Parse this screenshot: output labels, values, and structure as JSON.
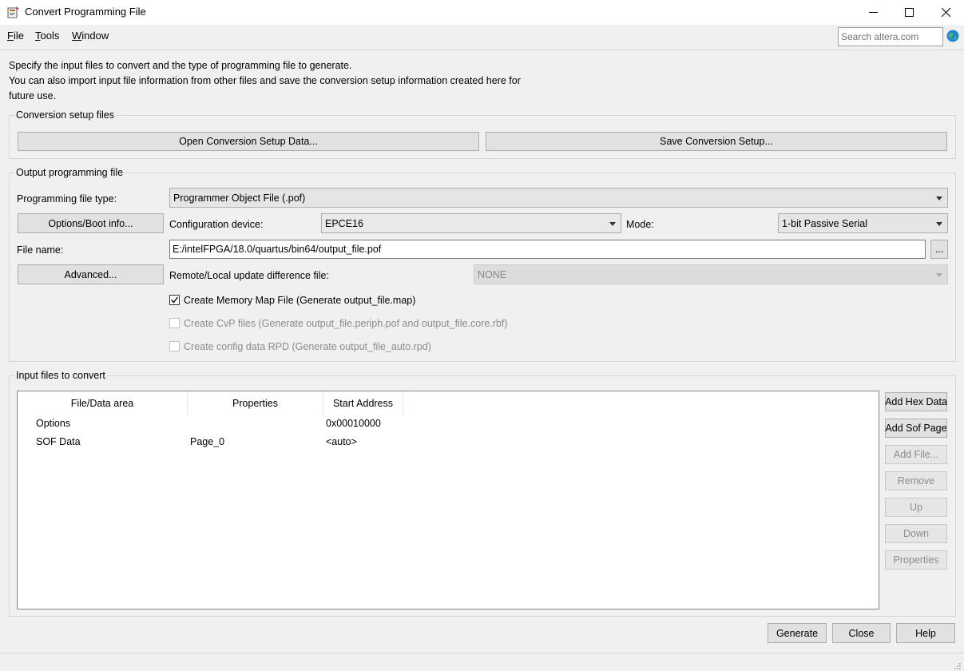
{
  "window": {
    "title": "Convert Programming File"
  },
  "menu": {
    "items": [
      {
        "underline": "F",
        "rest": "ile"
      },
      {
        "underline": "T",
        "rest": "ools"
      },
      {
        "underline": "W",
        "rest": "indow"
      }
    ]
  },
  "search": {
    "placeholder": "Search altera.com"
  },
  "description": {
    "line1": "Specify the input files to convert and the type of programming file to generate.",
    "line2": "You can also import input file information from other files and save the conversion setup information created here for",
    "line3": "future use."
  },
  "conversion_setup": {
    "title": "Conversion setup files",
    "open_button": "Open Conversion Setup Data...",
    "save_button": "Save Conversion Setup..."
  },
  "output": {
    "title": "Output programming file",
    "file_type_label": "Programming file type:",
    "file_type_value": "Programmer Object File (.pof)",
    "options_button": "Options/Boot info...",
    "config_device_label": "Configuration device:",
    "config_device_value": "EPCE16",
    "mode_label": "Mode:",
    "mode_value": "1-bit Passive Serial",
    "file_name_label": "File name:",
    "file_name_value": "E:/intelFPGA/18.0/quartus/bin64/output_file.pof",
    "browse_button": "...",
    "advanced_button": "Advanced...",
    "remote_label": "Remote/Local update difference file:",
    "remote_value": "NONE",
    "checkboxes": [
      {
        "label": "Create Memory Map File (Generate output_file.map)",
        "checked": true,
        "enabled": true
      },
      {
        "label": "Create CvP files (Generate output_file.periph.pof and output_file.core.rbf)",
        "checked": false,
        "enabled": false
      },
      {
        "label": "Create config data RPD (Generate output_file_auto.rpd)",
        "checked": false,
        "enabled": false
      }
    ]
  },
  "input": {
    "title": "Input files to convert",
    "columns": [
      "File/Data area",
      "Properties",
      "Start Address"
    ],
    "rows": [
      {
        "area": "Options",
        "properties": "",
        "address": "0x00010000"
      },
      {
        "area": "SOF Data",
        "properties": "Page_0",
        "address": "<auto>"
      }
    ],
    "buttons": {
      "add_hex": "Add Hex Data",
      "add_sof": "Add Sof Page",
      "add_file": "Add File...",
      "remove": "Remove",
      "up": "Up",
      "down": "Down",
      "properties": "Properties"
    }
  },
  "footer": {
    "generate": "Generate",
    "close": "Close",
    "help": "Help"
  }
}
